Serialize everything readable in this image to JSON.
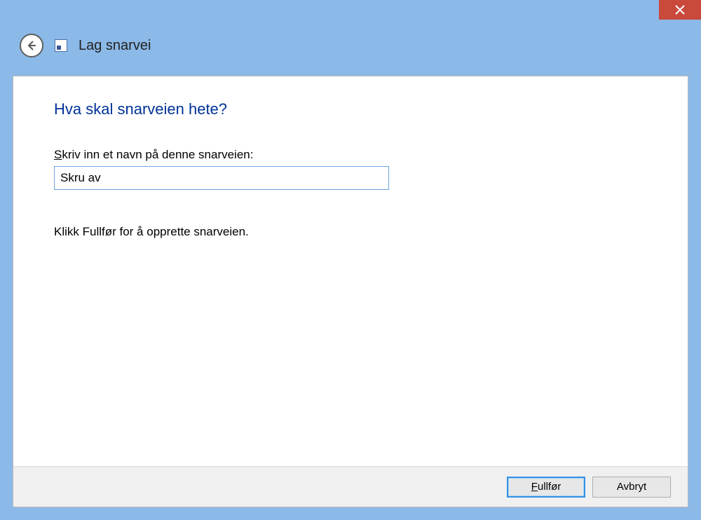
{
  "titlebar": {
    "close_icon": "close"
  },
  "header": {
    "back_icon": "back-arrow",
    "app_icon": "shortcut-file-icon",
    "title": "Lag snarvei"
  },
  "content": {
    "question": "Hva skal snarveien hete?",
    "field_label_prefix_accel": "S",
    "field_label_rest": "kriv inn et navn på denne snarveien:",
    "input_value": "Skru av",
    "instruction": "Klikk Fullfør for å opprette snarveien."
  },
  "footer": {
    "finish_accel": "F",
    "finish_rest": "ullfør",
    "cancel_label": "Avbryt"
  }
}
